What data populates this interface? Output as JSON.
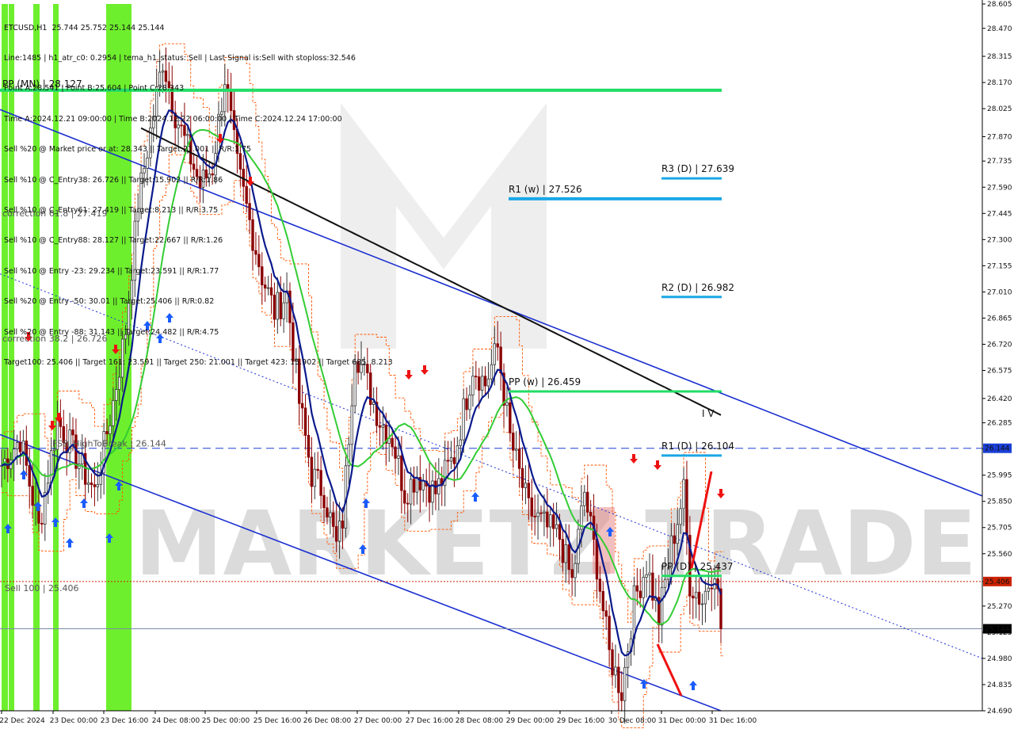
{
  "chart_data": {
    "type": "candlestick",
    "symbol_timeframe": "ETCUSD,H1",
    "ohlc_header": "25.744 25.752 25.144 25.144",
    "info_lines": [
      "Line:1485 | h1_atr_c0: 0.2954 | tema_h1_status: Sell | Last Signal is:Sell with stoploss:32.546",
      "Point A:28.541 | Point B:25.604 | Point C:28.343",
      "Time A:2024.12.21 09:00:00 | Time B:2024.12.22 06:00:00 | Time C:2024.12.24 17:00:00",
      "Sell %20 @ Market price or at: 28.343 || Target:21.001 || R/R:1.75",
      "Sell %10 @ C_Entry38: 26.726 || Target:15.902 || R/R:1.86",
      "Sell %10 @ C_Entry61: 27.419 || Target:8.213 || R/R:3.75",
      "Sell %10 @ C_Entry88: 28.127 || Target:22.667 || R/R:1.26",
      "Sell %10 @ Entry -23: 29.234 || Target:23.591 || R/R:1.77",
      "Sell %20 @ Entry -50: 30.01 || Target:25.406 || R/R:0.82",
      "Sell %20 @ Entry -88: 31.143 || Target:24.482 || R/R:4.75",
      "Target100: 25.406 || Target 161: 23.591 || Target 250: 21.001 || Target 423: 15.902 || Target 685: 8.213"
    ],
    "y_ticks": [
      "28.605",
      "28.470",
      "28.315",
      "28.170",
      "28.025",
      "27.870",
      "27.735",
      "27.590",
      "27.445",
      "27.300",
      "27.155",
      "27.010",
      "26.865",
      "26.720",
      "26.575",
      "26.420",
      "26.285",
      "26.140",
      "25.995",
      "25.850",
      "25.705",
      "25.560",
      "25.405",
      "25.270",
      "25.125",
      "24.980",
      "24.835",
      "24.690"
    ],
    "y_range": [
      24.69,
      28.605
    ],
    "x_ticks": [
      "22 Dec 2024",
      "23 Dec 00:00",
      "23 Dec 16:00",
      "24 Dec 08:00",
      "25 Dec 00:00",
      "25 Dec 16:00",
      "26 Dec 08:00",
      "27 Dec 00:00",
      "27 Dec 16:00",
      "28 Dec 08:00",
      "29 Dec 00:00",
      "29 Dec 16:00",
      "30 Dec 08:00",
      "31 Dec 00:00",
      "31 Dec 16:00"
    ],
    "price_markers": [
      {
        "label": "26.144",
        "value": 26.144,
        "bg": "#1a3fd6",
        "fg": "#ffffff"
      },
      {
        "label": "25.406",
        "value": 25.406,
        "bg": "#cc2200",
        "fg": "#ffffff"
      },
      {
        "label": "25.144",
        "value": 25.144,
        "bg": "#000000",
        "fg": "#ffffff"
      }
    ],
    "levels": [
      {
        "label": "R3 (D) | 27.639",
        "value": 27.639,
        "color": "#1aa7e6"
      },
      {
        "label": "R1 (w) | 27.526",
        "value": 27.526,
        "color": "#1aa7e6"
      },
      {
        "label": "R2 (D) | 26.982",
        "value": 26.982,
        "color": "#1aa7e6"
      },
      {
        "label": "PP (w) | 26.459",
        "value": 26.459,
        "color": "#22dd66"
      },
      {
        "label": "R1 (D) | 26.104",
        "value": 26.104,
        "color": "#1aa7e6"
      },
      {
        "label": "PP (D) | 25.437",
        "value": 25.437,
        "color": "#22dd66"
      },
      {
        "label": "PP (MN) | 28.127",
        "value": 28.127,
        "color": "#22dd66"
      }
    ],
    "side_labels": [
      {
        "label": "correction 61.8 | 27.419",
        "value": 27.419
      },
      {
        "label": "correction 38.2 | 26.726",
        "value": 26.726
      },
      {
        "label": "Sell 100 | 25.406",
        "value": 25.406
      },
      {
        "label": "FSB_HighToBreak | 26.144",
        "value": 26.144
      }
    ],
    "wave_label": "I V",
    "watermark": "MARKETZ TRADE",
    "colors": {
      "up_candle": "#333333",
      "down_candle": "#8b0000",
      "ema_black": "#111111",
      "ema_green": "#33cc33",
      "tema_navy": "#0a1a8c",
      "channel": "#1a2fd0",
      "band": "#ff5500",
      "signal_bar": "#66ee22",
      "up_arrow": "#1a5cff",
      "down_arrow": "#ee1111"
    },
    "close": 25.144,
    "path_waypoints": [
      [
        0,
        26.05
      ],
      [
        6,
        26.2
      ],
      [
        12,
        25.7
      ],
      [
        18,
        26.3
      ],
      [
        24,
        26.1
      ],
      [
        30,
        25.9
      ],
      [
        36,
        26.4
      ],
      [
        40,
        26.8
      ],
      [
        44,
        27.5
      ],
      [
        48,
        27.9
      ],
      [
        52,
        28.3
      ],
      [
        56,
        28.0
      ],
      [
        60,
        27.8
      ],
      [
        64,
        27.6
      ],
      [
        68,
        27.7
      ],
      [
        72,
        28.2
      ],
      [
        76,
        27.7
      ],
      [
        80,
        27.4
      ],
      [
        84,
        27.1
      ],
      [
        88,
        26.9
      ],
      [
        92,
        27.0
      ],
      [
        96,
        26.4
      ],
      [
        100,
        26.0
      ],
      [
        104,
        25.9
      ],
      [
        108,
        25.6
      ],
      [
        110,
        25.75
      ],
      [
        114,
        26.7
      ],
      [
        118,
        26.5
      ],
      [
        122,
        26.3
      ],
      [
        126,
        26.2
      ],
      [
        130,
        25.9
      ],
      [
        134,
        26.0
      ],
      [
        140,
        25.9
      ],
      [
        146,
        26.1
      ],
      [
        152,
        26.6
      ],
      [
        156,
        26.5
      ],
      [
        160,
        26.7
      ],
      [
        164,
        26.2
      ],
      [
        170,
        25.8
      ],
      [
        176,
        25.7
      ],
      [
        180,
        25.65
      ],
      [
        184,
        25.4
      ],
      [
        188,
        25.9
      ],
      [
        192,
        25.5
      ],
      [
        196,
        25.0
      ],
      [
        200,
        24.8
      ],
      [
        204,
        25.3
      ],
      [
        208,
        25.5
      ],
      [
        212,
        25.2
      ],
      [
        216,
        25.6
      ],
      [
        220,
        25.9
      ],
      [
        222,
        25.4
      ],
      [
        226,
        25.3
      ],
      [
        230,
        25.5
      ],
      [
        232,
        25.144
      ]
    ]
  }
}
